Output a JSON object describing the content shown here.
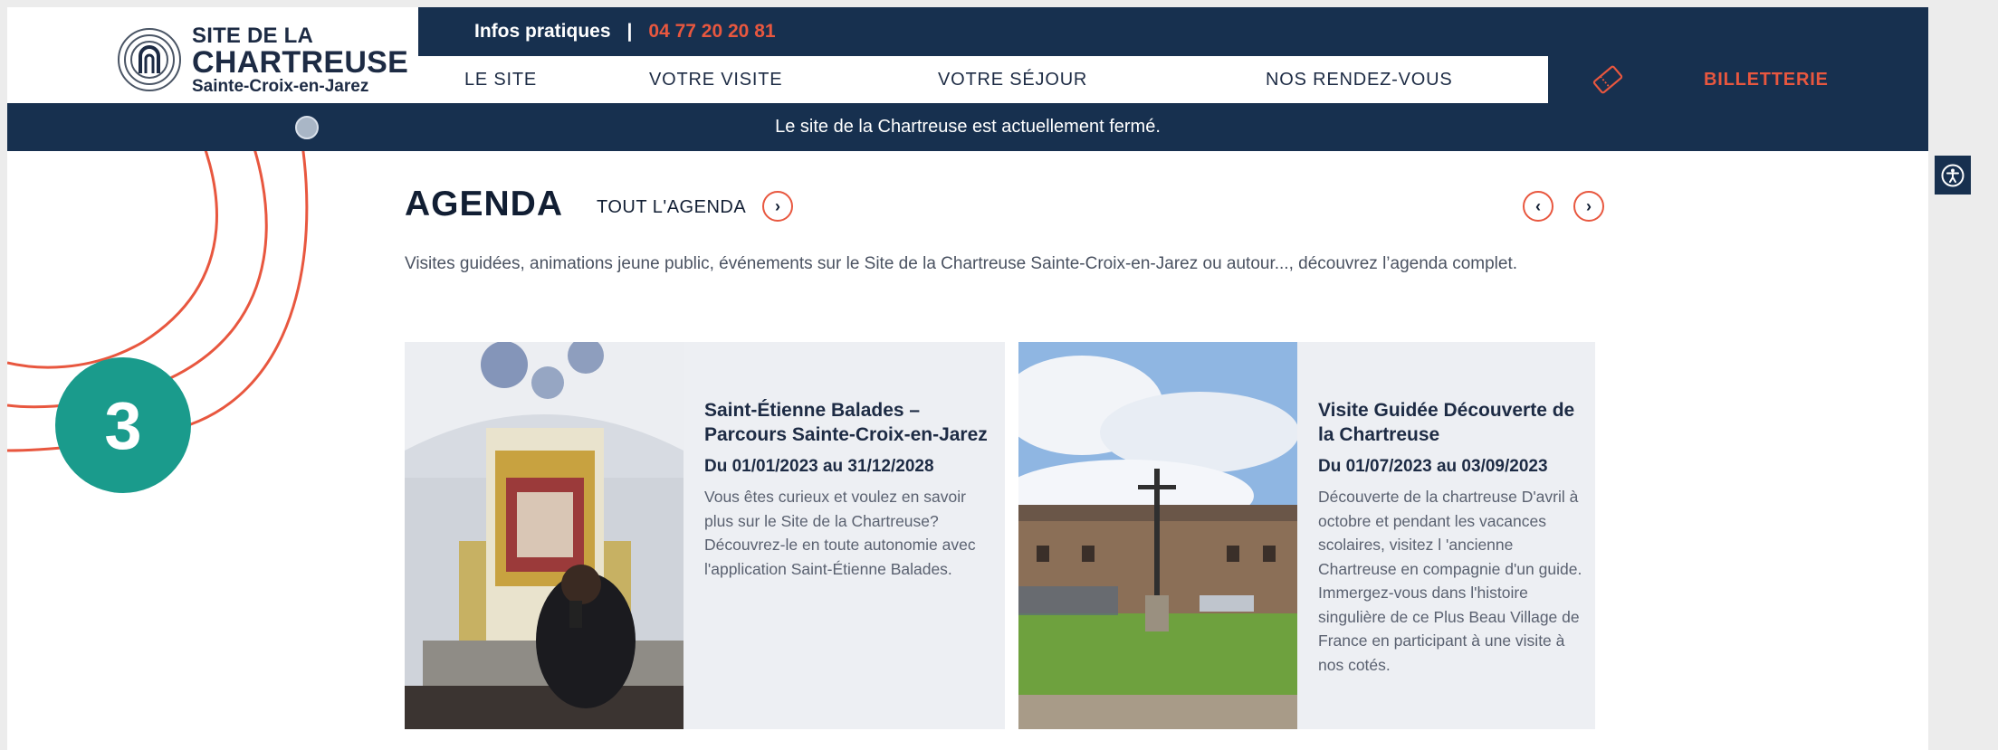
{
  "header": {
    "logo": {
      "line1": "SITE DE LA",
      "line2": "CHARTREUSE",
      "line3": "Sainte-Croix-en-Jarez"
    },
    "topbar": {
      "infos_label": "Infos pratiques",
      "separator": "|",
      "phone": "04 77 20 20 81"
    },
    "nav": [
      {
        "label": "LE SITE"
      },
      {
        "label": "VOTRE VISITE"
      },
      {
        "label": "VOTRE SÉJOUR"
      },
      {
        "label": "NOS RENDEZ-VOUS"
      }
    ],
    "billetterie_label": "BILLETTERIE"
  },
  "notice": {
    "text": "Le site de la Chartreuse est actuellement fermé."
  },
  "agenda": {
    "title": "AGENDA",
    "all_link": "TOUT L'AGENDA",
    "description": "Visites guidées, animations jeune public, événements sur le Site de la Chartreuse Sainte-Croix-en-Jarez ou autour..., découvrez l’agenda complet.",
    "cards": [
      {
        "title": "Saint-Étienne Balades – Parcours Sainte-Croix-en-Jarez",
        "date": "Du 01/01/2023 au 31/12/2028",
        "text": "Vous êtes curieux et voulez en savoir plus sur le Site de la Chartreuse? Découvrez-le en toute autonomie avec l'application Saint-Étienne Balades."
      },
      {
        "title": "Visite Guidée Découverte de la Chartreuse",
        "date": "Du 01/07/2023 au 03/09/2023",
        "text": "Découverte de la chartreuse D'avril à octobre et pendant les vacances scolaires, visitez l 'ancienne Chartreuse en compagnie d'un guide. Immergez-vous dans l'histoire singulière de ce Plus Beau Village de France en participant à une visite à nos cotés."
      }
    ]
  },
  "step_badge": {
    "number": "3"
  },
  "icons": {
    "arrow_right": "›",
    "arrow_left": "‹",
    "ticket": "ticket-icon",
    "accessibility": "accessibility-icon"
  },
  "colors": {
    "navy": "#17304f",
    "accent": "#e8573f",
    "badge": "#1a9b8c",
    "card_bg": "#edeff3"
  }
}
